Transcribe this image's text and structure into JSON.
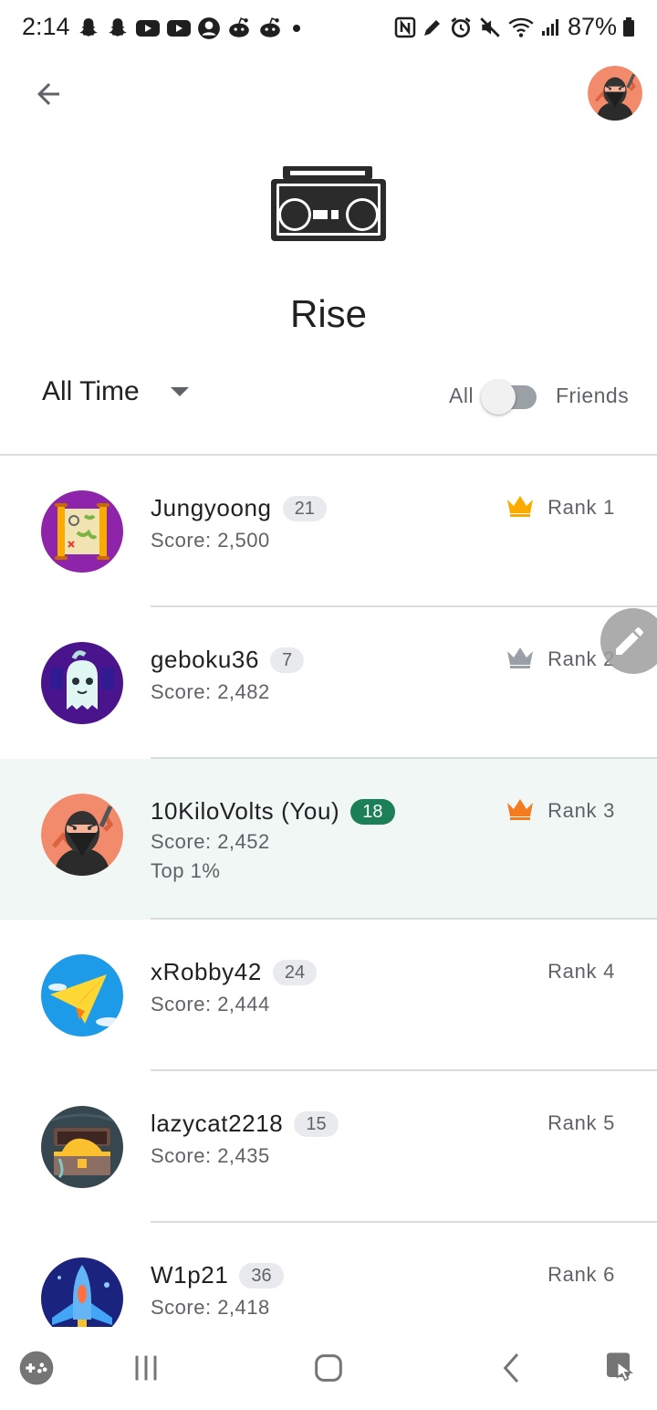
{
  "status_bar": {
    "time": "2:14",
    "battery": "87%",
    "left_icons": [
      "snapchat-icon",
      "snapchat-icon",
      "youtube-icon",
      "youtube-icon",
      "account-icon",
      "reddit-icon",
      "reddit-icon",
      "dot-icon"
    ],
    "right_icons": [
      "nfc-icon",
      "edit-icon",
      "alarm-icon",
      "mute-icon",
      "wifi-icon",
      "signal-icon",
      "battery-icon"
    ]
  },
  "header": {
    "back_icon": "back-arrow-icon",
    "avatar": "ninja-avatar"
  },
  "game": {
    "icon": "boombox-icon",
    "title": "Rise"
  },
  "filters": {
    "time_range": "All Time",
    "toggle_left_label": "All",
    "toggle_right_label": "Friends",
    "friends_only": false
  },
  "leaderboard": [
    {
      "name": "Jungyoong",
      "level": "21",
      "score": "Score: 2,500",
      "rank": "Rank 1",
      "crown": "gold",
      "avatar": "treasure-map",
      "is_you": false
    },
    {
      "name": "geboku36",
      "level": "7",
      "score": "Score: 2,482",
      "rank": "Rank 2",
      "crown": "silver",
      "avatar": "ghost",
      "is_you": false
    },
    {
      "name": "10KiloVolts (You)",
      "level": "18",
      "score": "Score: 2,452",
      "extra": "Top 1%",
      "rank": "Rank 3",
      "crown": "bronze",
      "avatar": "ninja",
      "is_you": true
    },
    {
      "name": "xRobby42",
      "level": "24",
      "score": "Score: 2,444",
      "rank": "Rank 4",
      "crown": null,
      "avatar": "paper-plane",
      "is_you": false
    },
    {
      "name": "lazycat2218",
      "level": "15",
      "score": "Score: 2,435",
      "rank": "Rank 5",
      "crown": null,
      "avatar": "treasure-chest",
      "is_you": false
    },
    {
      "name": "W1p21",
      "level": "36",
      "score": "Score: 2,418",
      "rank": "Rank 6",
      "crown": null,
      "avatar": "spaceship",
      "is_you": false
    }
  ],
  "colors": {
    "gold": "#F9AB00",
    "silver": "#9AA0A6",
    "bronze": "#F37C20",
    "you_badge": "#1B7F57",
    "highlight_row": "#F1F7F5"
  },
  "fab": {
    "icon": "pencil-icon"
  },
  "nav_bar": {
    "items": [
      "game-dashboard-icon",
      "recents-icon",
      "home-icon",
      "back-icon",
      "assistant-touch-icon"
    ]
  }
}
